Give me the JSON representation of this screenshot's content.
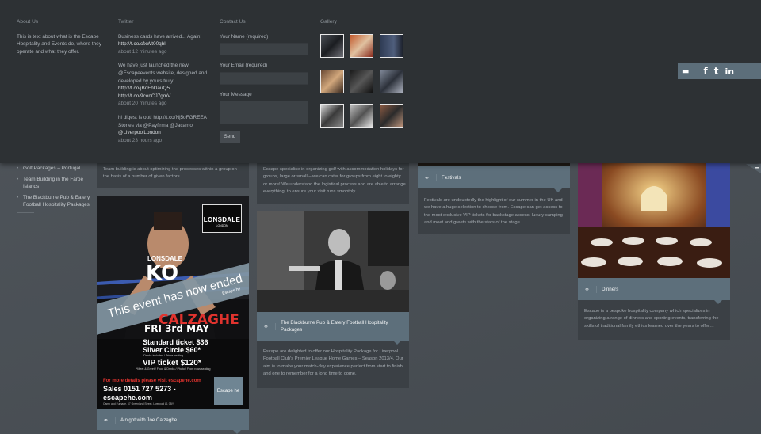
{
  "about": {
    "heading": "About Us",
    "text": "This is text about what is the Escape Hospitality and Events do, where they operate and what they offer."
  },
  "twitter": {
    "heading": "Twitter",
    "tweets": [
      {
        "lines": [
          "Business cards have arrived... Again!",
          "http://t.co/cfxWt00qbl"
        ],
        "time": "about 12 minutes ago"
      },
      {
        "lines": [
          "We have just launched the new",
          "@Escapeevents website, designed and",
          "developed by yours truly:",
          "http://t.co/jBdFhDauQ5",
          "http://t.co/9conCJ7gmV"
        ],
        "time": "about 20 minutes ago"
      },
      {
        "lines": [
          "hi digest is out! http://t.co/Nj5oFGREEA",
          "Stories via @Payfirma @Jacamo",
          "@LiverpoolLondon"
        ],
        "time": "about 23 hours ago"
      }
    ]
  },
  "contact": {
    "heading": "Contact Us",
    "name_label": "Your Name (required)",
    "email_label": "Your Email (required)",
    "message_label": "Your Message",
    "send_label": "Send"
  },
  "gallery": {
    "heading": "Gallery"
  },
  "sidebar": {
    "items": [
      "Golf Packages – Portugal",
      "Team Building in the Faroe Islands",
      "The Blackburne Pub & Eatery Football Hospitality Packages"
    ]
  },
  "cards": {
    "team": {
      "text": "Team building is about optimizing the processes within a group on the basis of a number of given factors."
    },
    "calzaghe": {
      "label": "A night with Joe Calzaghe",
      "poster": {
        "brand": "LONSDALE",
        "brand_sub": "LONDON",
        "shirt1": "LONSDALE",
        "shirt2": "KO",
        "banner": "This event has now ended",
        "banner_sub": "Escape he",
        "name": "CALZAGHE",
        "date": "FRI 3rd MAY",
        "ticket1": "Standard ticket $36",
        "ticket2": "Silver Circle $60*",
        "ticket2_sub": "*Drinks included / Prime seating",
        "ticket3": "VIP ticket $120*",
        "ticket3_sub": "*Meet & Greet / Food & Drinks / Photo / Front rows seating",
        "more": "For more details please visit escapehe.com",
        "sales": "Sales 0151 727 5273 -",
        "site": "escapehe.com",
        "address": "Camp and Furnace, 67 Greenland Street, Liverpool L1 0BY",
        "logo": "Escape he"
      }
    },
    "golf": {
      "text": "Escape specialise in organizing golf with accommodation holidays for groups, large or small – we can cater for groups from eight to eighty or more! We understand the logistical process and are able to arrange everything, to ensure your visit runs smoothly."
    },
    "blackburne": {
      "label": "The Blackburne Pub & Eatery Football Hospitality Packages",
      "text": "Escape are delighted to offer our Hospitality Package for Liverpool Football Club's Premier League Home Games – Season 2013/4. Our aim is to make your match-day experience perfect from start to finish, and one to remember for a long time to come."
    },
    "festivals": {
      "label": "Festivals",
      "text": "Festivals are undoubtedly the highlight of our summer in the UK and we have a huge selection to choose from. Escape can get access to the most exclusive VIP tickets for backstage access, luxury camping and meet and greets with the stars of the stage."
    },
    "dinners": {
      "label": "Dinners",
      "text": "Escape is a bespoke hospitality company which specializes in organizing a range of dinners and sporting events, transferring the skills of traditional family ethics learned over the years to offer…"
    }
  },
  "social": {
    "icons": [
      "chat-icon",
      "facebook-icon",
      "twitter-icon",
      "linkedin-icon"
    ],
    "glyphs": [
      "▬",
      "f",
      "t",
      "in"
    ]
  },
  "colors": {
    "panel": "#2d3134",
    "background": "#4a5056",
    "accent": "#5d6f7b"
  }
}
